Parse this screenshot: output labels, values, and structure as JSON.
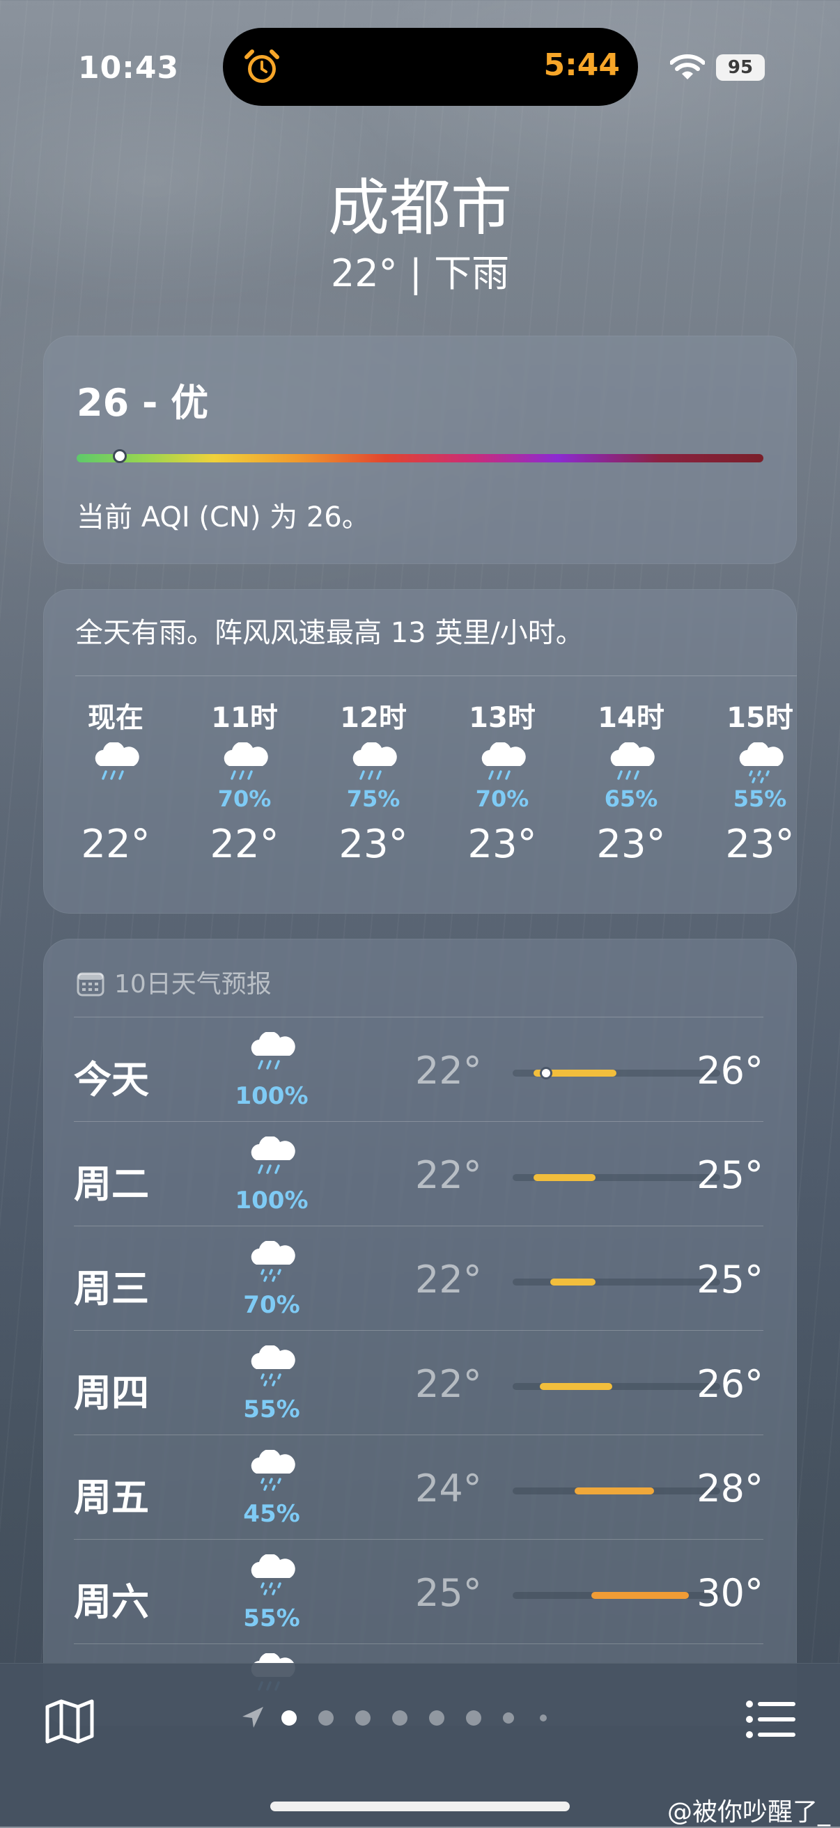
{
  "status_bar": {
    "time": "10:43",
    "timer": "5:44",
    "battery": "95",
    "alarm_icon": "alarm-clock-icon",
    "wifi_icon": "wifi-icon"
  },
  "location": {
    "city": "成都市",
    "summary": "22° | 下雨"
  },
  "aqi": {
    "value_label": "26 - 优",
    "description": "当前 AQI (CN) 为 26。",
    "level_fraction": 0.05,
    "bar_colors": [
      "#5ec96b",
      "#f0d23a",
      "#e1452f",
      "#8c2bd1",
      "#7a1f2a"
    ]
  },
  "hourly": {
    "description": "全天有雨。阵风风速最高 13 英里/小时。",
    "items": [
      {
        "label": "现在",
        "icon": "rain-cloud-icon",
        "pop": "",
        "temp": "22°"
      },
      {
        "label": "11时",
        "icon": "rain-cloud-icon",
        "pop": "70%",
        "temp": "22°"
      },
      {
        "label": "12时",
        "icon": "rain-cloud-icon",
        "pop": "75%",
        "temp": "23°"
      },
      {
        "label": "13时",
        "icon": "rain-cloud-icon",
        "pop": "70%",
        "temp": "23°"
      },
      {
        "label": "14时",
        "icon": "rain-cloud-icon",
        "pop": "65%",
        "temp": "23°"
      },
      {
        "label": "15时",
        "icon": "drizzle-cloud-icon",
        "pop": "55%",
        "temp": "23°"
      }
    ]
  },
  "daily": {
    "title": "10日天气预报",
    "range_min": 21,
    "range_max": 31,
    "items": [
      {
        "day": "今天",
        "icon": "rain-cloud-icon",
        "pop": "100%",
        "low": "22°",
        "high": "26°",
        "low_val": 22,
        "high_val": 26,
        "bar_color": "#f2be3c",
        "current_val": 22.6
      },
      {
        "day": "周二",
        "icon": "rain-cloud-icon",
        "pop": "100%",
        "low": "22°",
        "high": "25°",
        "low_val": 22,
        "high_val": 25,
        "bar_color": "#f2be3c"
      },
      {
        "day": "周三",
        "icon": "drizzle-cloud-icon",
        "pop": "70%",
        "low": "22°",
        "high": "25°",
        "low_val": 22.8,
        "high_val": 25,
        "bar_color": "#f2be3c"
      },
      {
        "day": "周四",
        "icon": "drizzle-cloud-icon",
        "pop": "55%",
        "low": "22°",
        "high": "26°",
        "low_val": 22.3,
        "high_val": 25.8,
        "bar_color": "#f2be3c"
      },
      {
        "day": "周五",
        "icon": "drizzle-cloud-icon",
        "pop": "45%",
        "low": "24°",
        "high": "28°",
        "low_val": 24,
        "high_val": 27.8,
        "bar_color": "#f0a83a"
      },
      {
        "day": "周六",
        "icon": "drizzle-cloud-icon",
        "pop": "55%",
        "low": "25°",
        "high": "30°",
        "low_val": 24.8,
        "high_val": 29.5,
        "bar_color": "#f09c36"
      }
    ]
  },
  "bottom_bar": {
    "map_icon": "map-icon",
    "location_icon": "location-arrow-icon",
    "list_icon": "list-icon",
    "page_count": 9,
    "current_page": 1,
    "watermark": "@被你吵醒了_"
  }
}
